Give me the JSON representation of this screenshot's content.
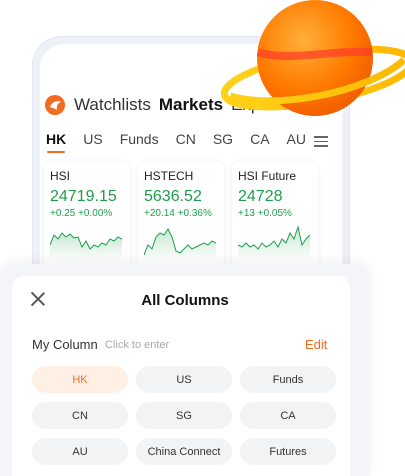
{
  "nav": {
    "items": [
      "Watchlists",
      "Markets",
      "Explore"
    ],
    "active": 1
  },
  "tabs": {
    "items": [
      "HK",
      "US",
      "Funds",
      "CN",
      "SG",
      "CA",
      "AU"
    ],
    "active": 0
  },
  "cards": [
    {
      "name": "HSI",
      "price": "24719.15",
      "change": "+0.25 +0.00%"
    },
    {
      "name": "HSTECH",
      "price": "5636.52",
      "change": "+20.14 +0.36%"
    },
    {
      "name": "HSI Future",
      "price": "24728",
      "change": "+13 +0.05%"
    }
  ],
  "sheet": {
    "title": "All Columns",
    "my_column": "My Column",
    "hint": "Click to enter",
    "edit": "Edit"
  },
  "chips": [
    "HK",
    "US",
    "Funds",
    "CN",
    "SG",
    "CA",
    "AU",
    "China Connect",
    "Futures"
  ],
  "colors": {
    "accent": "#f26b21",
    "up": "#1e9e4a"
  }
}
